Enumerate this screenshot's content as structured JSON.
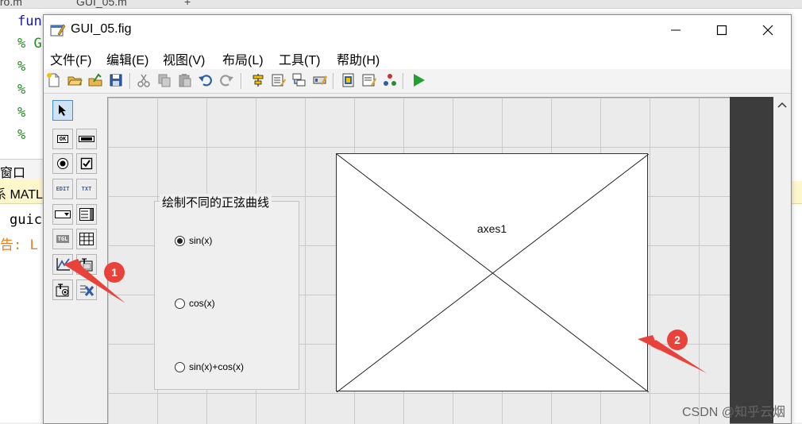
{
  "background_editor": {
    "tabs": [
      "tro.m",
      "GUI_05.m",
      "+"
    ],
    "code_lines": [
      {
        "text": "fun",
        "color": "#1a1aa6"
      },
      {
        "text": "% G",
        "color": "#228b22"
      },
      {
        "text": "%",
        "color": "#228b22"
      },
      {
        "text": "%",
        "color": "#228b22"
      },
      {
        "text": "%",
        "color": "#228b22"
      },
      {
        "text": "%",
        "color": "#228b22"
      }
    ],
    "panel_title": "窗口",
    "notice": "系 MATL",
    "cmd_line": "guic",
    "warn_line": "告: L"
  },
  "window": {
    "title": "GUI_05.fig",
    "controls": {
      "minimize": "minimize-icon",
      "maximize": "maximize-icon",
      "close": "close-icon"
    }
  },
  "menu": [
    "文件(F)",
    "编辑(E)",
    "视图(V)",
    "布局(L)",
    "工具(T)",
    "帮助(H)"
  ],
  "toolbar_icons": [
    "new-icon",
    "open-icon",
    "save-as-icon",
    "save-icon",
    "cut-icon",
    "copy-icon",
    "paste-icon",
    "undo-icon",
    "redo-icon",
    "align-icon",
    "menu-editor-icon",
    "tab-order-icon",
    "toolbar-editor-icon",
    "editor-icon",
    "property-inspector-icon",
    "object-browser-icon",
    "run-icon"
  ],
  "palette": [
    {
      "name": "select-tool",
      "label": ""
    },
    {
      "name": "push-button-tool",
      "label": "OK"
    },
    {
      "name": "slider-tool",
      "label": ""
    },
    {
      "name": "radio-button-tool",
      "label": ""
    },
    {
      "name": "checkbox-tool",
      "label": ""
    },
    {
      "name": "edit-text-tool",
      "label": "EDIT"
    },
    {
      "name": "static-text-tool",
      "label": "TXT"
    },
    {
      "name": "popup-menu-tool",
      "label": ""
    },
    {
      "name": "listbox-tool",
      "label": ""
    },
    {
      "name": "toggle-button-tool",
      "label": "TGL"
    },
    {
      "name": "table-tool",
      "label": ""
    },
    {
      "name": "axes-tool",
      "label": ""
    },
    {
      "name": "panel-tool",
      "label": "T"
    },
    {
      "name": "button-group-tool",
      "label": "T"
    },
    {
      "name": "activex-tool",
      "label": ""
    }
  ],
  "button_group": {
    "title": "绘制不同的正弦曲线",
    "options": [
      {
        "label": "sin(x)",
        "selected": true
      },
      {
        "label": "cos(x)",
        "selected": false
      },
      {
        "label": "sin(x)+cos(x)",
        "selected": false
      }
    ]
  },
  "axes": {
    "label": "axes1"
  },
  "annotations": [
    "1",
    "2"
  ],
  "annotation_color": "#e8423a",
  "watermark": "CSDN @知乎云烟"
}
